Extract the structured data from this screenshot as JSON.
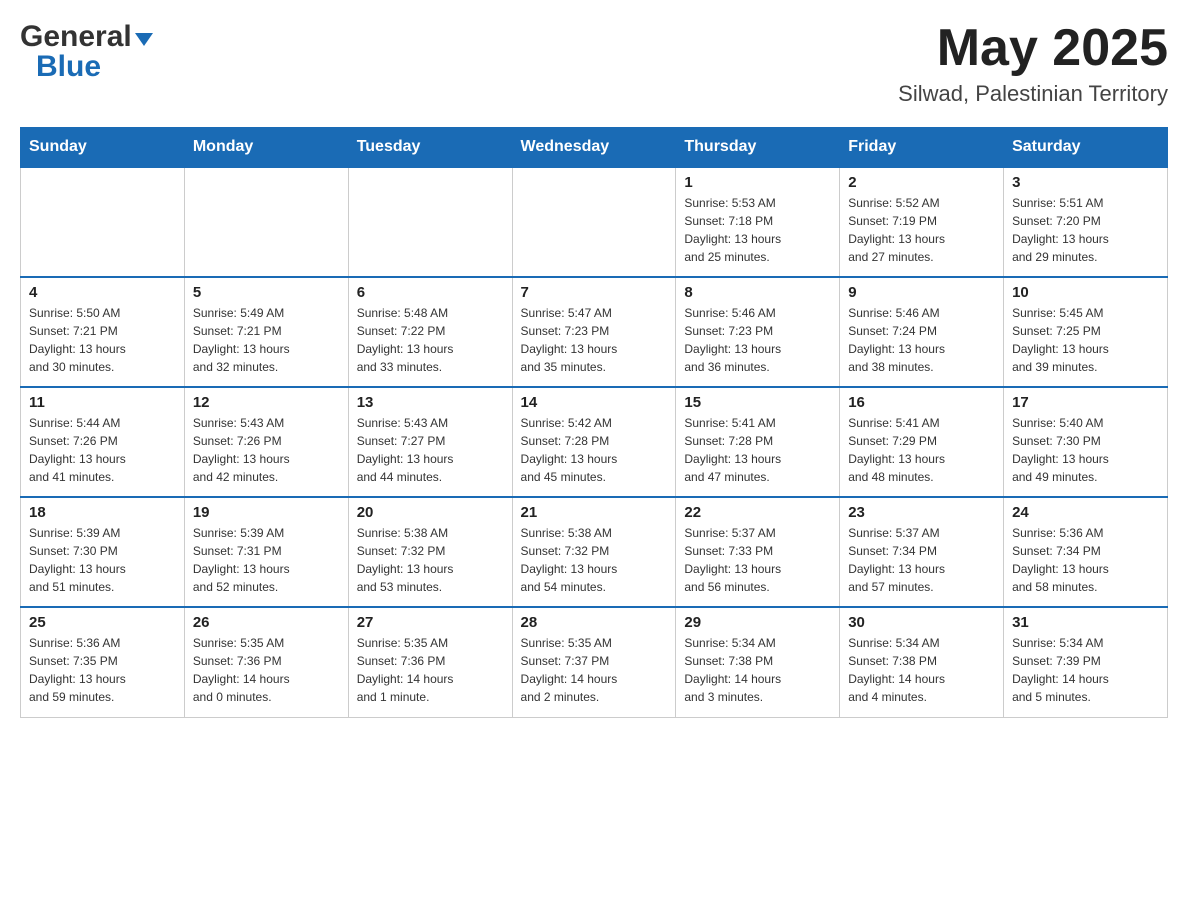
{
  "header": {
    "logo_general": "General",
    "logo_blue": "Blue",
    "title": "May 2025",
    "subtitle": "Silwad, Palestinian Territory"
  },
  "calendar": {
    "days_of_week": [
      "Sunday",
      "Monday",
      "Tuesday",
      "Wednesday",
      "Thursday",
      "Friday",
      "Saturday"
    ],
    "weeks": [
      [
        {
          "day": "",
          "info": ""
        },
        {
          "day": "",
          "info": ""
        },
        {
          "day": "",
          "info": ""
        },
        {
          "day": "",
          "info": ""
        },
        {
          "day": "1",
          "info": "Sunrise: 5:53 AM\nSunset: 7:18 PM\nDaylight: 13 hours\nand 25 minutes."
        },
        {
          "day": "2",
          "info": "Sunrise: 5:52 AM\nSunset: 7:19 PM\nDaylight: 13 hours\nand 27 minutes."
        },
        {
          "day": "3",
          "info": "Sunrise: 5:51 AM\nSunset: 7:20 PM\nDaylight: 13 hours\nand 29 minutes."
        }
      ],
      [
        {
          "day": "4",
          "info": "Sunrise: 5:50 AM\nSunset: 7:21 PM\nDaylight: 13 hours\nand 30 minutes."
        },
        {
          "day": "5",
          "info": "Sunrise: 5:49 AM\nSunset: 7:21 PM\nDaylight: 13 hours\nand 32 minutes."
        },
        {
          "day": "6",
          "info": "Sunrise: 5:48 AM\nSunset: 7:22 PM\nDaylight: 13 hours\nand 33 minutes."
        },
        {
          "day": "7",
          "info": "Sunrise: 5:47 AM\nSunset: 7:23 PM\nDaylight: 13 hours\nand 35 minutes."
        },
        {
          "day": "8",
          "info": "Sunrise: 5:46 AM\nSunset: 7:23 PM\nDaylight: 13 hours\nand 36 minutes."
        },
        {
          "day": "9",
          "info": "Sunrise: 5:46 AM\nSunset: 7:24 PM\nDaylight: 13 hours\nand 38 minutes."
        },
        {
          "day": "10",
          "info": "Sunrise: 5:45 AM\nSunset: 7:25 PM\nDaylight: 13 hours\nand 39 minutes."
        }
      ],
      [
        {
          "day": "11",
          "info": "Sunrise: 5:44 AM\nSunset: 7:26 PM\nDaylight: 13 hours\nand 41 minutes."
        },
        {
          "day": "12",
          "info": "Sunrise: 5:43 AM\nSunset: 7:26 PM\nDaylight: 13 hours\nand 42 minutes."
        },
        {
          "day": "13",
          "info": "Sunrise: 5:43 AM\nSunset: 7:27 PM\nDaylight: 13 hours\nand 44 minutes."
        },
        {
          "day": "14",
          "info": "Sunrise: 5:42 AM\nSunset: 7:28 PM\nDaylight: 13 hours\nand 45 minutes."
        },
        {
          "day": "15",
          "info": "Sunrise: 5:41 AM\nSunset: 7:28 PM\nDaylight: 13 hours\nand 47 minutes."
        },
        {
          "day": "16",
          "info": "Sunrise: 5:41 AM\nSunset: 7:29 PM\nDaylight: 13 hours\nand 48 minutes."
        },
        {
          "day": "17",
          "info": "Sunrise: 5:40 AM\nSunset: 7:30 PM\nDaylight: 13 hours\nand 49 minutes."
        }
      ],
      [
        {
          "day": "18",
          "info": "Sunrise: 5:39 AM\nSunset: 7:30 PM\nDaylight: 13 hours\nand 51 minutes."
        },
        {
          "day": "19",
          "info": "Sunrise: 5:39 AM\nSunset: 7:31 PM\nDaylight: 13 hours\nand 52 minutes."
        },
        {
          "day": "20",
          "info": "Sunrise: 5:38 AM\nSunset: 7:32 PM\nDaylight: 13 hours\nand 53 minutes."
        },
        {
          "day": "21",
          "info": "Sunrise: 5:38 AM\nSunset: 7:32 PM\nDaylight: 13 hours\nand 54 minutes."
        },
        {
          "day": "22",
          "info": "Sunrise: 5:37 AM\nSunset: 7:33 PM\nDaylight: 13 hours\nand 56 minutes."
        },
        {
          "day": "23",
          "info": "Sunrise: 5:37 AM\nSunset: 7:34 PM\nDaylight: 13 hours\nand 57 minutes."
        },
        {
          "day": "24",
          "info": "Sunrise: 5:36 AM\nSunset: 7:34 PM\nDaylight: 13 hours\nand 58 minutes."
        }
      ],
      [
        {
          "day": "25",
          "info": "Sunrise: 5:36 AM\nSunset: 7:35 PM\nDaylight: 13 hours\nand 59 minutes."
        },
        {
          "day": "26",
          "info": "Sunrise: 5:35 AM\nSunset: 7:36 PM\nDaylight: 14 hours\nand 0 minutes."
        },
        {
          "day": "27",
          "info": "Sunrise: 5:35 AM\nSunset: 7:36 PM\nDaylight: 14 hours\nand 1 minute."
        },
        {
          "day": "28",
          "info": "Sunrise: 5:35 AM\nSunset: 7:37 PM\nDaylight: 14 hours\nand 2 minutes."
        },
        {
          "day": "29",
          "info": "Sunrise: 5:34 AM\nSunset: 7:38 PM\nDaylight: 14 hours\nand 3 minutes."
        },
        {
          "day": "30",
          "info": "Sunrise: 5:34 AM\nSunset: 7:38 PM\nDaylight: 14 hours\nand 4 minutes."
        },
        {
          "day": "31",
          "info": "Sunrise: 5:34 AM\nSunset: 7:39 PM\nDaylight: 14 hours\nand 5 minutes."
        }
      ]
    ]
  }
}
